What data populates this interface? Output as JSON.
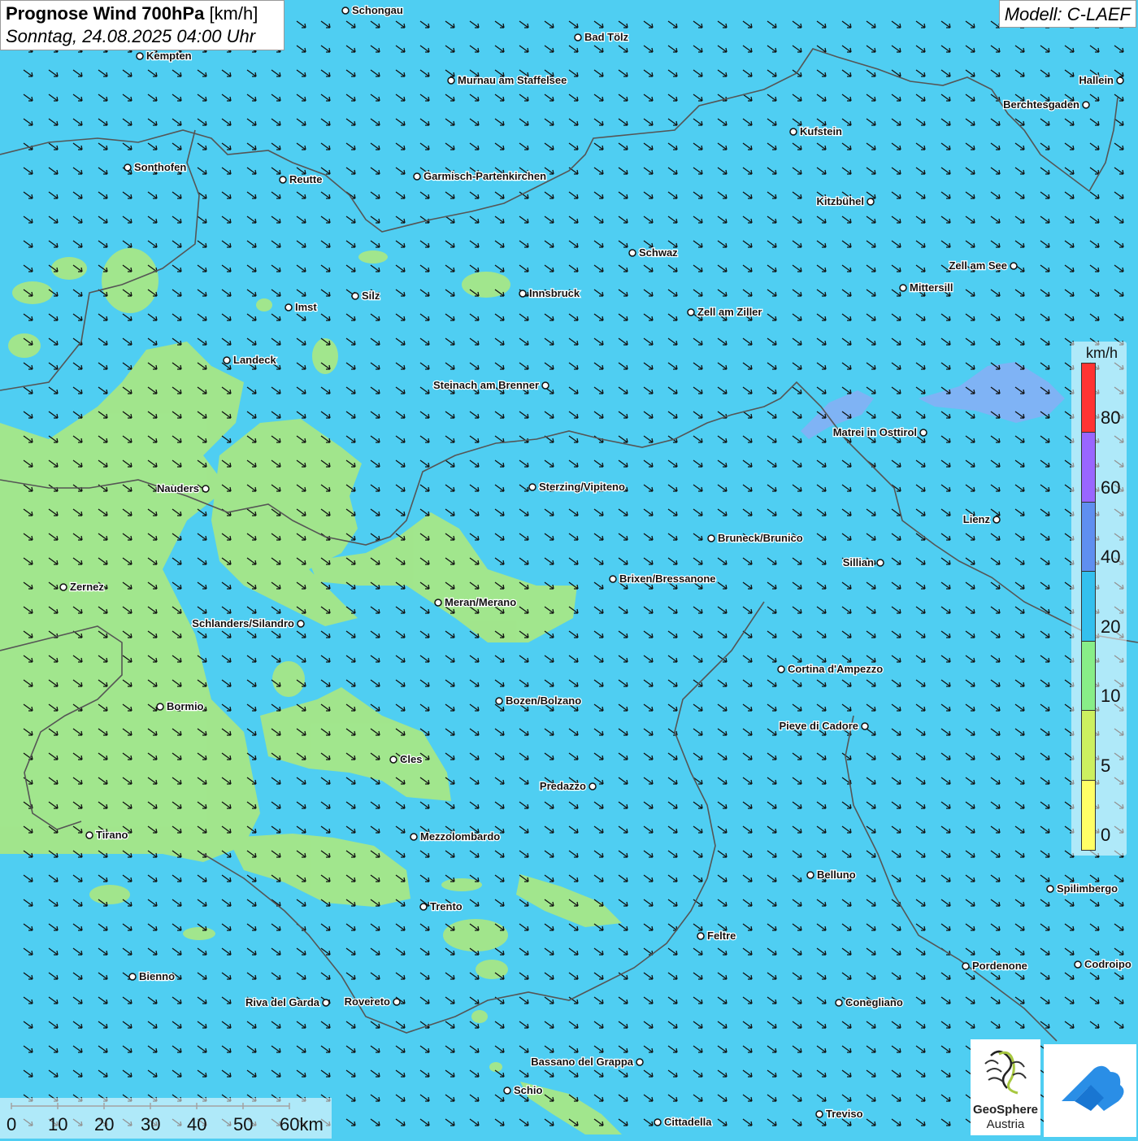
{
  "title": {
    "main": "Prognose Wind 700hPa",
    "unit": "[km/h]",
    "datetime": "Sonntag, 24.08.2025 04:00 Uhr"
  },
  "model": "Modell: C-LAEF",
  "legend": {
    "unit": "km/h",
    "labels": [
      "80",
      "60",
      "40",
      "20",
      "10",
      "5",
      "0"
    ],
    "colors": [
      "#ff3333",
      "#9966ff",
      "#5f8ff0",
      "#33c0ee",
      "#88ee88",
      "#ccf060",
      "#ffff66"
    ]
  },
  "scale": {
    "labels": [
      "0",
      "10",
      "20",
      "30",
      "40",
      "50",
      "60km"
    ]
  },
  "logos": {
    "geosphere_line1": "GeoSphere",
    "geosphere_line2": "Austria"
  },
  "wind_direction": "from northwest",
  "cities": [
    {
      "name": "Schongau",
      "label_side": "right"
    },
    {
      "name": "Bad Tölz",
      "label_side": "right"
    },
    {
      "name": "Kempten",
      "label_side": "right"
    },
    {
      "name": "Murnau am Staffelsee",
      "label_side": "right"
    },
    {
      "name": "Hallein",
      "label_side": "left"
    },
    {
      "name": "Berchtesgaden",
      "label_side": "left"
    },
    {
      "name": "Kufstein",
      "label_side": "right"
    },
    {
      "name": "Sonthofen",
      "label_side": "right"
    },
    {
      "name": "Reutte",
      "label_side": "right"
    },
    {
      "name": "Garmisch-Partenkirchen",
      "label_side": "right"
    },
    {
      "name": "Kitzbühel",
      "label_side": "left"
    },
    {
      "name": "Schwaz",
      "label_side": "right"
    },
    {
      "name": "Zell am See",
      "label_side": "left"
    },
    {
      "name": "Innsbruck",
      "label_side": "right"
    },
    {
      "name": "Silz",
      "label_side": "right"
    },
    {
      "name": "Imst",
      "label_side": "right"
    },
    {
      "name": "Mittersill",
      "label_side": "right"
    },
    {
      "name": "Zell am Ziller",
      "label_side": "right"
    },
    {
      "name": "Landeck",
      "label_side": "right"
    },
    {
      "name": "Steinach am Brenner",
      "label_side": "left"
    },
    {
      "name": "Matrei in Osttirol",
      "label_side": "left"
    },
    {
      "name": "Nauders",
      "label_side": "left"
    },
    {
      "name": "Sterzing/Vipiteno",
      "label_side": "right"
    },
    {
      "name": "Lienz",
      "label_side": "left"
    },
    {
      "name": "Bruneck/Brunico",
      "label_side": "right"
    },
    {
      "name": "Sillian",
      "label_side": "left"
    },
    {
      "name": "Zernez",
      "label_side": "right"
    },
    {
      "name": "Brixen/Bressanone",
      "label_side": "right"
    },
    {
      "name": "Meran/Merano",
      "label_side": "right"
    },
    {
      "name": "Schlanders/Silandro",
      "label_side": "left"
    },
    {
      "name": "Cortina d'Ampezzo",
      "label_side": "right"
    },
    {
      "name": "Bozen/Bolzano",
      "label_side": "right"
    },
    {
      "name": "Bormio",
      "label_side": "right"
    },
    {
      "name": "Pieve di Cadore",
      "label_side": "left"
    },
    {
      "name": "Cles",
      "label_side": "right"
    },
    {
      "name": "Predazzo",
      "label_side": "left"
    },
    {
      "name": "Tirano",
      "label_side": "right"
    },
    {
      "name": "Mezzolombardo",
      "label_side": "right"
    },
    {
      "name": "Belluno",
      "label_side": "right"
    },
    {
      "name": "Spilimbergo",
      "label_side": "right"
    },
    {
      "name": "Trento",
      "label_side": "right"
    },
    {
      "name": "Feltre",
      "label_side": "right"
    },
    {
      "name": "Pordenone",
      "label_side": "right"
    },
    {
      "name": "Codroipo",
      "label_side": "right"
    },
    {
      "name": "Bienno",
      "label_side": "right"
    },
    {
      "name": "Riva del Garda",
      "label_side": "left"
    },
    {
      "name": "Rovereto",
      "label_side": "left"
    },
    {
      "name": "Conegliano",
      "label_side": "right"
    },
    {
      "name": "Bassano del Grappa",
      "label_side": "left"
    },
    {
      "name": "Schio",
      "label_side": "right"
    },
    {
      "name": "Treviso",
      "label_side": "right"
    },
    {
      "name": "Cittadella",
      "label_side": "right"
    }
  ]
}
